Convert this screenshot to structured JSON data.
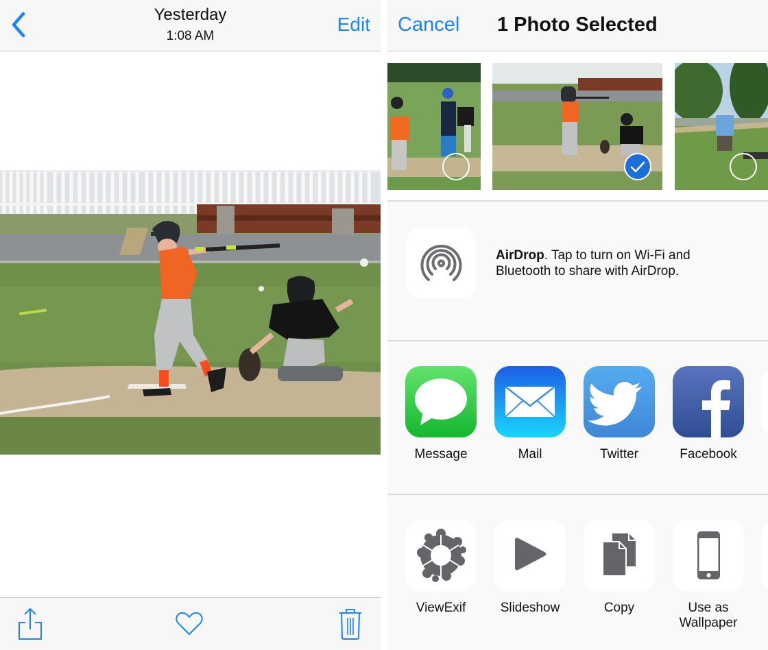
{
  "photo_viewer": {
    "nav": {
      "back_icon": "chevron-left-icon",
      "title": "Yesterday",
      "subtitle": "1:08 AM",
      "edit_label": "Edit"
    },
    "photo": {
      "description": "Youth baseball batter in orange jersey swinging, catcher in black kneeling behind home plate"
    },
    "toolbar": {
      "share_icon": "share-icon",
      "favorite_icon": "heart-icon",
      "delete_icon": "trash-icon"
    }
  },
  "share_sheet": {
    "nav": {
      "cancel_label": "Cancel",
      "title": "1 Photo Selected"
    },
    "thumbnails": [
      {
        "description": "Kids standing on baseball field",
        "selected": false
      },
      {
        "description": "Batter swinging with catcher",
        "selected": true
      },
      {
        "description": "Man in blue shirt on field with trees",
        "selected": false
      }
    ],
    "airdrop": {
      "icon": "airdrop-icon",
      "bold": "AirDrop",
      "text": ". Tap to turn on Wi-Fi and Bluetooth to share with AirDrop."
    },
    "share_apps": [
      {
        "label": "Message",
        "icon": "message-icon",
        "color": "#2fc94a"
      },
      {
        "label": "Mail",
        "icon": "mail-icon",
        "color": "#1f8ff5"
      },
      {
        "label": "Twitter",
        "icon": "twitter-icon",
        "color": "#4a9de0"
      },
      {
        "label": "Facebook",
        "icon": "facebook-icon",
        "color": "#3b5aa3"
      }
    ],
    "actions": [
      {
        "label": "ViewExif",
        "icon": "puzzle-ring-icon"
      },
      {
        "label": "Slideshow",
        "icon": "play-icon"
      },
      {
        "label": "Copy",
        "icon": "copy-icon"
      },
      {
        "label": "Use as\nWallpaper",
        "label_line1": "Use as",
        "label_line2": "Wallpaper",
        "icon": "phone-icon"
      }
    ]
  },
  "colors": {
    "accent": "#1a82fb",
    "selected_check": "#1c6fd8",
    "icon_gray": "#646469"
  }
}
